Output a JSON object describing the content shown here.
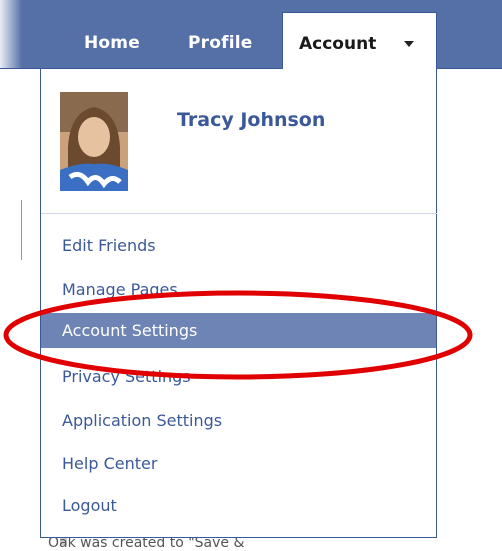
{
  "nav": {
    "home_label": "Home",
    "profile_label": "Profile",
    "account_label": "Account"
  },
  "user": {
    "name": "Tracy Johnson"
  },
  "menu": {
    "items": [
      {
        "label": "Edit Friends"
      },
      {
        "label": "Manage Pages"
      },
      {
        "label": "Account Settings"
      },
      {
        "label": "Privacy Settings"
      },
      {
        "label": "Application Settings"
      },
      {
        "label": "Help Center"
      },
      {
        "label": "Logout"
      }
    ],
    "active_index": 2
  },
  "background": {
    "snippet_text": "Oak was created to \"Save &"
  },
  "colors": {
    "topbar": "#5570a6",
    "link": "#3b5998",
    "active_item": "#6d84b4",
    "annotation": "#e00000"
  },
  "icons": {
    "dropdown_arrow": "chevron-down-icon"
  }
}
